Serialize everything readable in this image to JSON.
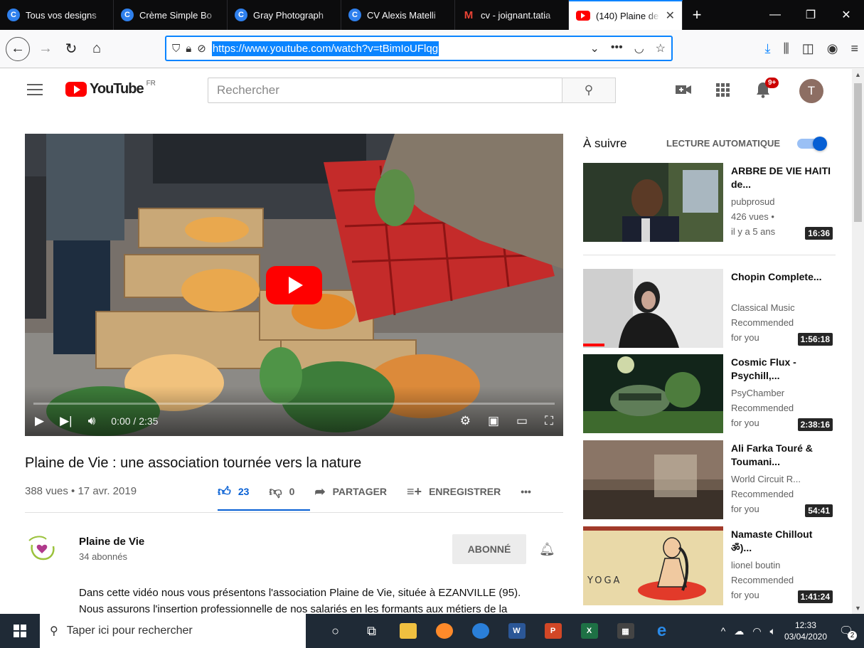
{
  "browser": {
    "tabs": [
      {
        "title": "Tous vos designs",
        "icon": "C"
      },
      {
        "title": "Crème Simple Bo",
        "icon": "C"
      },
      {
        "title": "Gray Photograph",
        "icon": "C"
      },
      {
        "title": "CV Alexis Matelli",
        "icon": "C"
      },
      {
        "title": "cv - joignant.tatia",
        "icon": "M"
      },
      {
        "title": "(140) Plaine de",
        "icon": ""
      }
    ],
    "url": "https://www.youtube.com/watch?v=tBimIoUFlqg"
  },
  "youtube": {
    "logo_text": "YouTube",
    "region": "FR",
    "search_placeholder": "Rechercher",
    "notification_badge": "9+",
    "avatar_letter": "T"
  },
  "video": {
    "time": "0:00 / 2:35",
    "title": "Plaine de Vie : une association tournée vers la nature",
    "meta": "388 vues • 17 avr. 2019",
    "likes": "23",
    "dislikes": "0",
    "share_label": "PARTAGER",
    "save_label": "ENREGISTRER",
    "more": "•••"
  },
  "channel": {
    "name": "Plaine de Vie",
    "subscribers": "34 abonnés",
    "subscribe_label": "ABONNÉ",
    "description_1": "Dans cette vidéo nous vous présentons l'association Plaine de Vie, située à EZANVILLE (95).",
    "description_2": "Nous assurons l'insertion professionnelle de nos salariés en les formants aux métiers de la"
  },
  "sidebar": {
    "up_next": "À suivre",
    "autoplay_label": "LECTURE AUTOMATIQUE",
    "items": [
      {
        "title": "ARBRE DE VIE HAITI de...",
        "channel": "pubprosud",
        "line2": "426 vues •",
        "line3": "il y a 5 ans",
        "duration": "16:36"
      },
      {
        "title": "Chopin Complete...",
        "channel": "Classical Music",
        "line2": "Recommended",
        "line3": "for you",
        "duration": "1:56:18"
      },
      {
        "title": "Cosmic Flux - Psychill,...",
        "channel": "PsyChamber",
        "line2": "Recommended",
        "line3": "for you",
        "duration": "2:38:16"
      },
      {
        "title": "Ali Farka Touré & Toumani...",
        "channel": "World Circuit R...",
        "line2": "Recommended",
        "line3": "for you",
        "duration": "54:41"
      },
      {
        "title": "Namaste Chillout ॐ)...",
        "channel": "lionel boutin",
        "line2": "Recommended",
        "line3": "for you",
        "duration": "1:41:24"
      }
    ],
    "thumb_text_yoga": "YOGA"
  },
  "taskbar": {
    "search_placeholder": "Taper ici pour rechercher",
    "time": "12:33",
    "date": "03/04/2020",
    "notifications": "2"
  }
}
